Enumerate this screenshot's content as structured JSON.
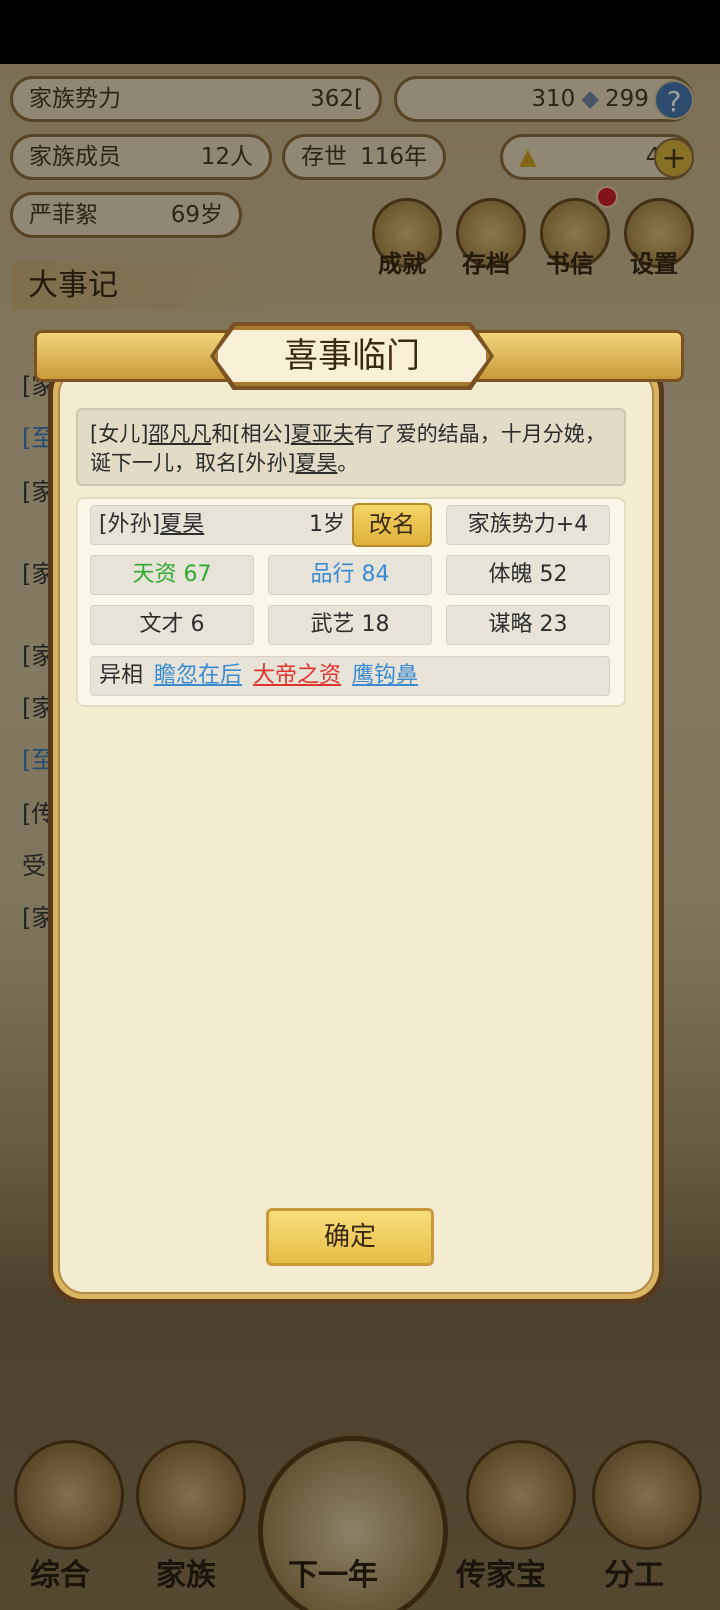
{
  "background": {
    "clan_power": {
      "label": "家族势力",
      "value": "362["
    },
    "currency": {
      "silver": "310",
      "copper": "299"
    },
    "clan_members": {
      "label": "家族成员",
      "value": "12人"
    },
    "years": {
      "label": "存世",
      "value": "116年"
    },
    "gold": "44",
    "person": {
      "name": "严菲絮",
      "age": "69岁"
    },
    "round_buttons": [
      "成就",
      "存档",
      "书信",
      "设置"
    ],
    "events_title": "大事记",
    "left_fragments": [
      "[家",
      "[至",
      "[家",
      "[家",
      "[家",
      "[家",
      "[至",
      "[传",
      "受",
      "[家"
    ],
    "bottom_nav": [
      "综合",
      "家族",
      "下一年",
      "传家宝",
      "分工"
    ]
  },
  "modal": {
    "title": "喜事临门",
    "description": {
      "p1": "[女儿]",
      "mother": "邵凡凡",
      "p2": "和[相公]",
      "father": "夏亚夫",
      "p3": "有了爱的结晶，十月分娩，诞下一儿，取名[外孙]",
      "child": "夏昊",
      "p4": "。"
    },
    "child_info": {
      "relation": "[外孙]",
      "name": "夏昊",
      "age": "1岁",
      "rename_label": "改名",
      "clan_power_bonus": "家族势力+4"
    },
    "stats": {
      "talent": "天资 67",
      "conduct": "品行 84",
      "physique": "体魄 52",
      "literary": "文才 6",
      "martial": "武艺 18",
      "strategy": "谋略 23"
    },
    "traits_label": "异相",
    "traits": [
      {
        "text": "瞻忽在后",
        "color": "#3a8ad2"
      },
      {
        "text": "大帝之资",
        "color": "#e0342a"
      },
      {
        "text": "鹰钩鼻",
        "color": "#3a8ad2"
      }
    ],
    "confirm_label": "确定"
  }
}
